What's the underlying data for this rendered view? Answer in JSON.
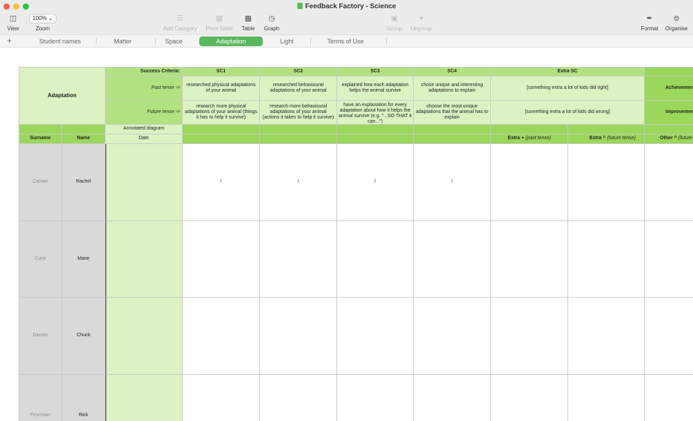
{
  "window": {
    "title": "Feedback Factory - Science"
  },
  "toolbar": {
    "view": "View",
    "zoom_value": "100%",
    "zoom": "Zoom",
    "add_category": "Add Category",
    "pivot_table": "Pivot Table",
    "table": "Table",
    "graph": "Graph",
    "group": "Group",
    "ungroup": "Ungroup",
    "format": "Format",
    "organise": "Organise"
  },
  "tabs": {
    "add": "+",
    "items": [
      "Student names",
      "Matter",
      "Space",
      "Adaptation",
      "Light",
      "Terms of Use"
    ],
    "active": "Adaptation"
  },
  "sheet": {
    "topic": "Adaptation",
    "success_criteria_label": "Success Criteria:",
    "past_label": "Past tense ->",
    "future_label": "Future tense ->",
    "criteria": [
      {
        "code": "SC1",
        "past": "researched physical adaptations of your animal",
        "future": "research more physical adaptations of your animal (things it has to help it survive)"
      },
      {
        "code": "SC2",
        "past": "researched behavioural adaptations of your animal",
        "future": "research more behavioural adaptations of your animal (actions it takes to help it survive)"
      },
      {
        "code": "SC3",
        "past": "explained how each adaptation helps the animal survive",
        "future": "have an explanation for every adaptation about how it helps the animal survive (e.g. \"...SO THAT it can...\")"
      },
      {
        "code": "SC4",
        "past": "chose unique and interesting adaptations to explain",
        "future": "choose the most unique adaptations that the animal has to explain"
      }
    ],
    "extra_sc": "Extra SC",
    "extra_past": "[something extra a lot of kids did right]",
    "extra_future": "[something extra a lot of kids did wrong]",
    "achievement": "Achievemer",
    "improvement": "Improvemer",
    "annotated_diagram": "Annotated diagram",
    "headers": {
      "surname": "Surname",
      "name": "Name",
      "date": "Date",
      "extra_plus": "Extra +",
      "extra_plus_note": "(past tense)",
      "extra_caret": "Extra ^",
      "extra_caret_note": "(future tense)",
      "other_caret": "Other ^",
      "other_caret_note": "(future"
    },
    "students": [
      {
        "surname": "Carson",
        "name": "Rachel",
        "marks": [
          "/",
          "/",
          "/",
          "/"
        ]
      },
      {
        "surname": "Curie",
        "name": "Marie",
        "marks": [
          "",
          "",
          "",
          ""
        ]
      },
      {
        "surname": "Darwin",
        "name": "Chuck",
        "marks": [
          "",
          "",
          "",
          ""
        ]
      },
      {
        "surname": "Feynman",
        "name": "Rick",
        "marks": [
          "",
          "",
          "",
          ""
        ]
      }
    ]
  }
}
